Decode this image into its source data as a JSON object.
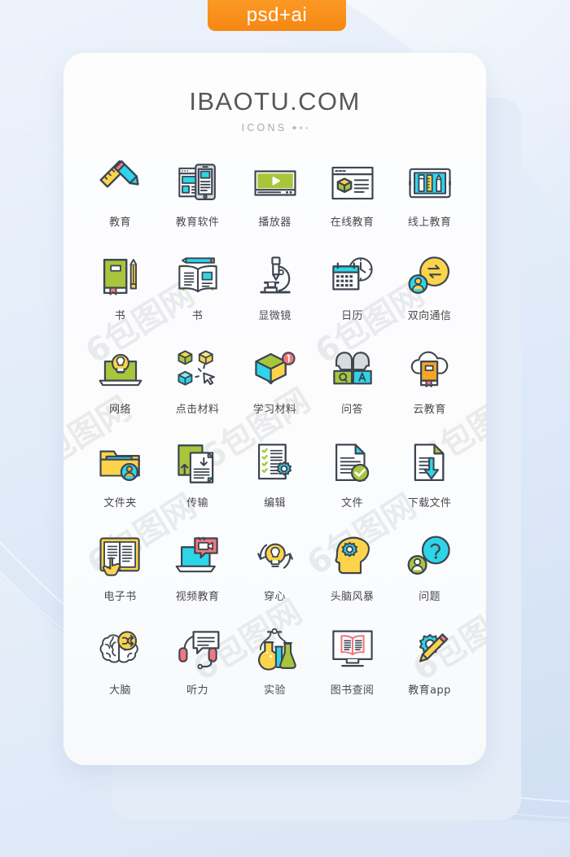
{
  "badge": {
    "label": "psd+ai"
  },
  "header": {
    "brand": "IBAOTU.COM",
    "subtitle": "ICONS"
  },
  "watermark": {
    "text": "6包图网"
  },
  "colors": {
    "badge_orange": "#f68712",
    "background_blue": "#dbe7f7",
    "card_white": "#fdfdfe",
    "outline": "#3d4551",
    "green": "#a8c63c",
    "cyan": "#2ed5e8",
    "yellow": "#fcd34b",
    "orange": "#f5a623",
    "red": "#f2787f",
    "gray": "#d7dade",
    "label_text": "#4a4a4c"
  },
  "grid": {
    "columns": 5,
    "rows": 6,
    "icons": [
      {
        "label": "教育",
        "name": "pencil-ruler-icon"
      },
      {
        "label": "教育软件",
        "name": "education-software-icon"
      },
      {
        "label": "播放器",
        "name": "video-player-icon"
      },
      {
        "label": "在线教育",
        "name": "online-education-icon"
      },
      {
        "label": "线上教育",
        "name": "tablet-education-icon"
      },
      {
        "label": "书",
        "name": "book-pencil-icon"
      },
      {
        "label": "书",
        "name": "open-book-pencil-icon"
      },
      {
        "label": "显微镜",
        "name": "microscope-icon"
      },
      {
        "label": "日历",
        "name": "calendar-clock-icon"
      },
      {
        "label": "双向通信",
        "name": "two-way-communication-icon"
      },
      {
        "label": "网络",
        "name": "laptop-bulb-icon"
      },
      {
        "label": "点击材料",
        "name": "click-material-icon"
      },
      {
        "label": "学习材料",
        "name": "learning-material-icon"
      },
      {
        "label": "问答",
        "name": "question-answer-icon"
      },
      {
        "label": "云教育",
        "name": "cloud-education-icon"
      },
      {
        "label": "文件夹",
        "name": "user-folder-icon"
      },
      {
        "label": "传输",
        "name": "file-transfer-icon"
      },
      {
        "label": "编辑",
        "name": "edit-document-icon"
      },
      {
        "label": "文件",
        "name": "verified-file-icon"
      },
      {
        "label": "下载文件",
        "name": "download-file-icon"
      },
      {
        "label": "电子书",
        "name": "ebook-touch-icon"
      },
      {
        "label": "视频教育",
        "name": "video-education-icon"
      },
      {
        "label": "穿心",
        "name": "bulb-refresh-icon"
      },
      {
        "label": "头脑风暴",
        "name": "brainstorm-gear-icon"
      },
      {
        "label": "问题",
        "name": "user-question-icon"
      },
      {
        "label": "大脑",
        "name": "brain-shuffle-icon"
      },
      {
        "label": "听力",
        "name": "headset-chat-icon"
      },
      {
        "label": "实验",
        "name": "lab-experiment-icon"
      },
      {
        "label": "图书查阅",
        "name": "book-monitor-icon"
      },
      {
        "label": "教育app",
        "name": "education-app-icon"
      }
    ]
  }
}
